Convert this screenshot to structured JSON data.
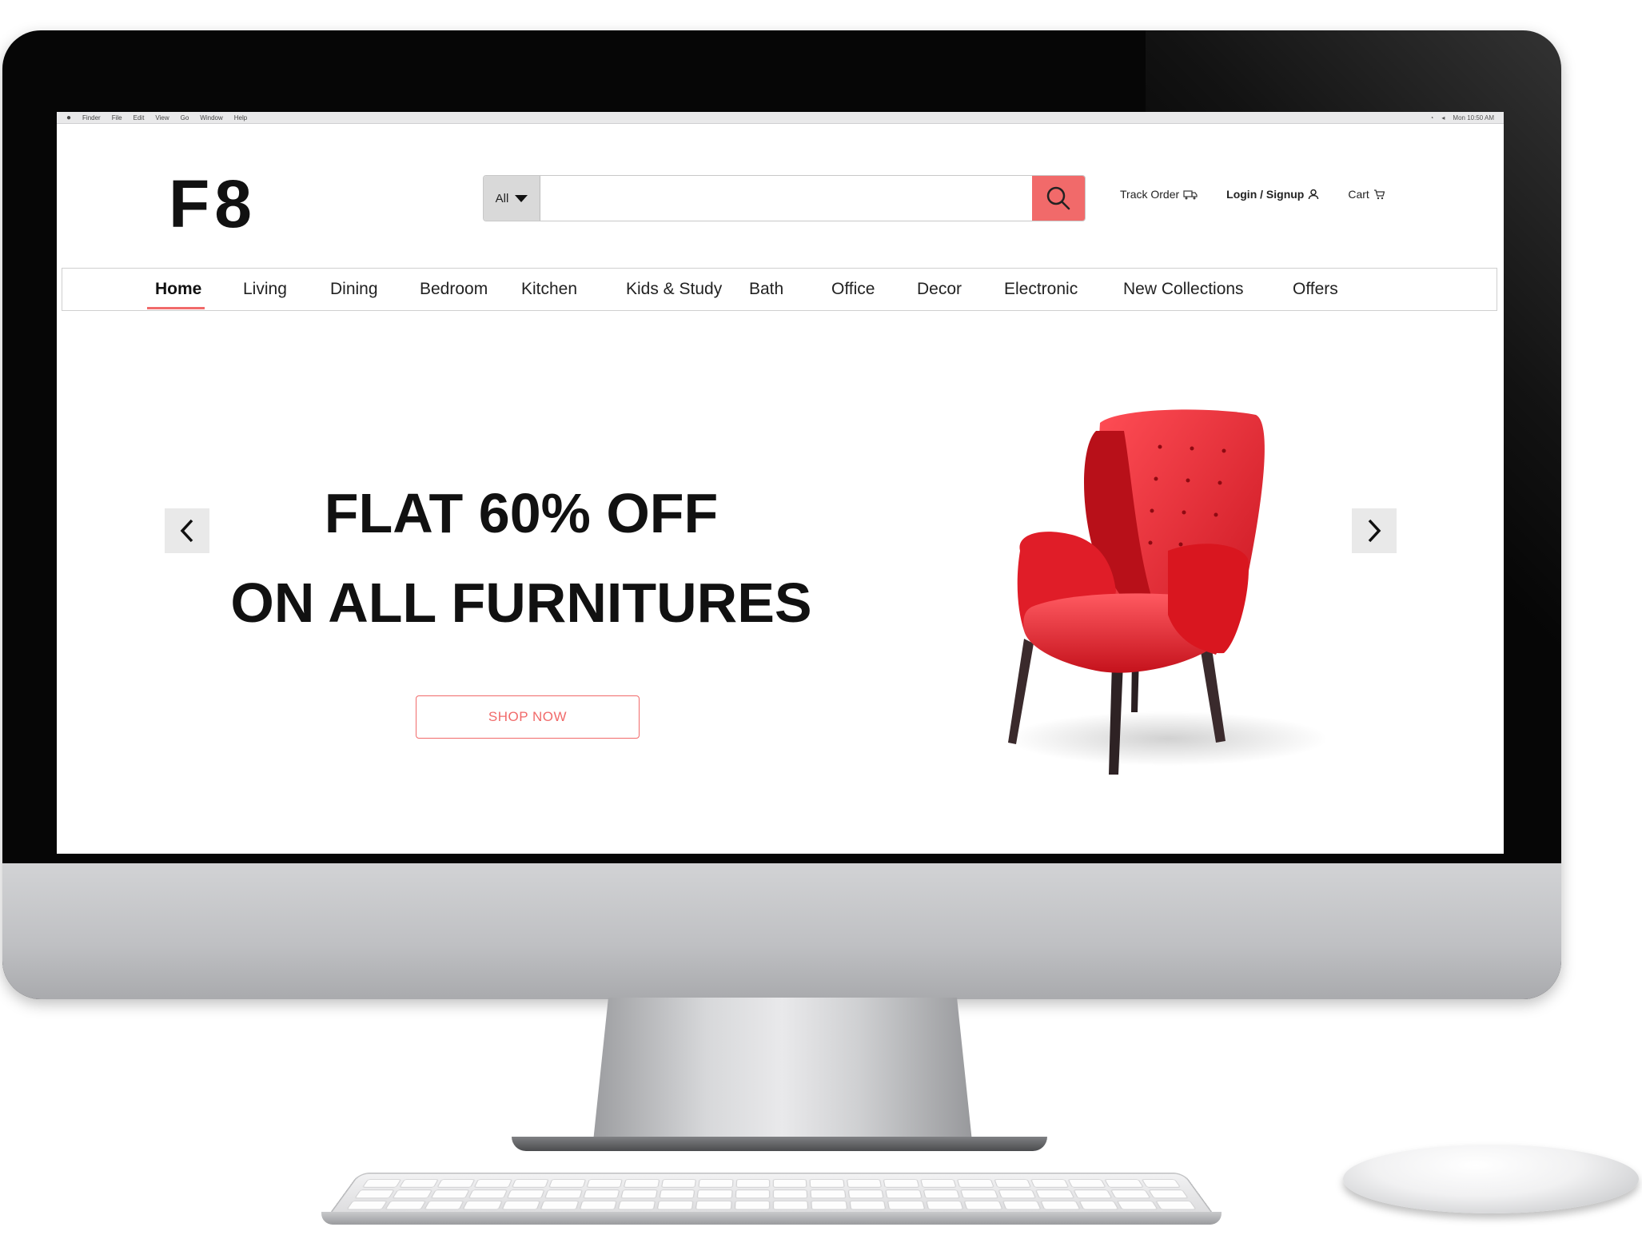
{
  "menubar": {
    "items": [
      "Finder",
      "File",
      "Edit",
      "View",
      "Go",
      "Window",
      "Help"
    ],
    "clock": "Mon 10:50 AM"
  },
  "brand": {
    "logo": "F8",
    "accent": "#f16a6a"
  },
  "search": {
    "category": "All",
    "placeholder": "",
    "value": ""
  },
  "header_links": {
    "track_order": "Track Order",
    "login": "Login / Signup",
    "cart": "Cart"
  },
  "nav": {
    "items": [
      "Home",
      "Living",
      "Dining",
      "Bedroom",
      "Kitchen",
      "Kids & Study",
      "Bath",
      "Office",
      "Decor",
      "Electronic",
      "New Collections",
      "Offers"
    ],
    "active": "Home"
  },
  "hero": {
    "line1": "FLAT 60% OFF",
    "line2": "ON ALL FURNITURES",
    "cta": "SHOP NOW",
    "image": "red-armchair"
  },
  "icons": [
    "search-icon",
    "truck-icon",
    "user-icon",
    "cart-icon",
    "chevron-left-icon",
    "chevron-right-icon",
    "caret-down-icon"
  ]
}
